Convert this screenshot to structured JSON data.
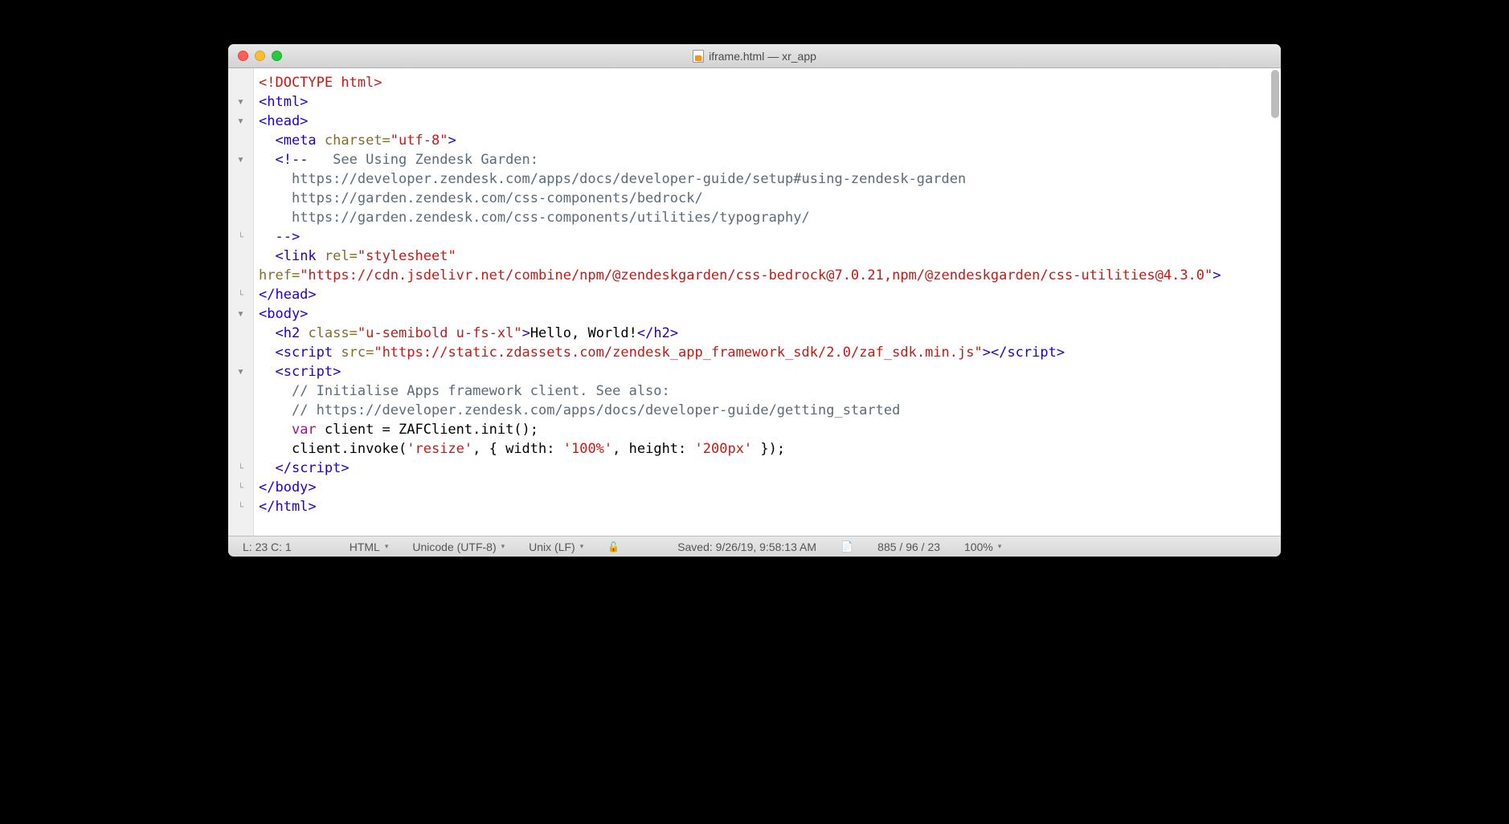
{
  "window": {
    "title": "iframe.html — xr_app"
  },
  "gutter": {
    "markers": [
      "",
      "▾",
      "▾",
      "",
      "▾",
      "",
      "",
      "",
      "∟",
      "",
      "",
      "∟",
      "▾",
      "",
      "",
      "▾",
      "",
      "",
      "",
      "",
      "∟",
      "∟",
      "∟"
    ]
  },
  "code": {
    "lines": [
      {
        "indent": 0,
        "tokens": [
          {
            "c": "c-doctype",
            "t": "<!DOCTYPE html>"
          }
        ]
      },
      {
        "indent": 0,
        "tokens": [
          {
            "c": "c-tag",
            "t": "<html>"
          }
        ]
      },
      {
        "indent": 0,
        "tokens": [
          {
            "c": "c-tag",
            "t": "<head>"
          }
        ]
      },
      {
        "indent": 1,
        "tokens": [
          {
            "c": "c-tag",
            "t": "<meta "
          },
          {
            "c": "c-attr",
            "t": "charset="
          },
          {
            "c": "c-str",
            "t": "\"utf-8\""
          },
          {
            "c": "c-tag",
            "t": ">"
          }
        ]
      },
      {
        "indent": 1,
        "tokens": [
          {
            "c": "c-tag",
            "t": "<!--"
          },
          {
            "c": "c-comment",
            "t": "   See Using Zendesk Garden:"
          }
        ]
      },
      {
        "indent": 2,
        "tokens": [
          {
            "c": "c-comment",
            "t": "https://developer.zendesk.com/apps/docs/developer-guide/setup#using-zendesk-garden"
          }
        ]
      },
      {
        "indent": 2,
        "tokens": [
          {
            "c": "c-comment",
            "t": "https://garden.zendesk.com/css-components/bedrock/"
          }
        ]
      },
      {
        "indent": 2,
        "tokens": [
          {
            "c": "c-comment",
            "t": "https://garden.zendesk.com/css-components/utilities/typography/"
          }
        ]
      },
      {
        "indent": 1,
        "tokens": [
          {
            "c": "c-tag",
            "t": "-->"
          }
        ]
      },
      {
        "indent": 1,
        "tokens": [
          {
            "c": "c-tag",
            "t": "<link "
          },
          {
            "c": "c-attr",
            "t": "rel="
          },
          {
            "c": "c-str",
            "t": "\"stylesheet\""
          }
        ]
      },
      {
        "indent": -1,
        "tokens": [
          {
            "c": "c-attr",
            "t": "href="
          },
          {
            "c": "c-str",
            "t": "\"https://cdn.jsdelivr.net/combine/npm/@zendeskgarden/css-bedrock@7.0.21,npm/@zendeskgarden/css-utilities@4.3.0\""
          },
          {
            "c": "c-tag",
            "t": ">"
          }
        ]
      },
      {
        "indent": 0,
        "tokens": [
          {
            "c": "c-tag",
            "t": "</head>"
          }
        ]
      },
      {
        "indent": 0,
        "tokens": [
          {
            "c": "c-tag",
            "t": "<body>"
          }
        ]
      },
      {
        "indent": 1,
        "tokens": [
          {
            "c": "c-tag",
            "t": "<h2 "
          },
          {
            "c": "c-attr",
            "t": "class="
          },
          {
            "c": "c-str",
            "t": "\"u-semibold u-fs-xl\""
          },
          {
            "c": "c-tag",
            "t": ">"
          },
          {
            "c": "c-text",
            "t": "Hello, World!"
          },
          {
            "c": "c-tag",
            "t": "</h2>"
          }
        ]
      },
      {
        "indent": 1,
        "tokens": [
          {
            "c": "c-tag",
            "t": "<script "
          },
          {
            "c": "c-attr",
            "t": "src="
          },
          {
            "c": "c-str",
            "t": "\"https://static.zdassets.com/zendesk_app_framework_sdk/2.0/zaf_sdk.min.js\""
          },
          {
            "c": "c-tag",
            "t": ">"
          },
          {
            "c": "c-tag",
            "t": "</script>"
          }
        ]
      },
      {
        "indent": 1,
        "tokens": [
          {
            "c": "c-tag",
            "t": "<script>"
          }
        ]
      },
      {
        "indent": 2,
        "tokens": [
          {
            "c": "c-comment",
            "t": "// Initialise Apps framework client. See also:"
          }
        ]
      },
      {
        "indent": 2,
        "tokens": [
          {
            "c": "c-comment",
            "t": "// https://developer.zendesk.com/apps/docs/developer-guide/getting_started"
          }
        ]
      },
      {
        "indent": 2,
        "tokens": [
          {
            "c": "c-kw",
            "t": "var"
          },
          {
            "c": "c-punc",
            "t": " client = ZAFClient.init();"
          }
        ]
      },
      {
        "indent": 2,
        "tokens": [
          {
            "c": "c-punc",
            "t": "client.invoke("
          },
          {
            "c": "c-jsstr",
            "t": "'resize'"
          },
          {
            "c": "c-punc",
            "t": ", { width: "
          },
          {
            "c": "c-jsstr",
            "t": "'100%'"
          },
          {
            "c": "c-punc",
            "t": ", height: "
          },
          {
            "c": "c-jsstr",
            "t": "'200px'"
          },
          {
            "c": "c-punc",
            "t": " });"
          }
        ]
      },
      {
        "indent": 1,
        "tokens": [
          {
            "c": "c-tag",
            "t": "</script>"
          }
        ]
      },
      {
        "indent": 0,
        "tokens": [
          {
            "c": "c-tag",
            "t": "</body>"
          }
        ]
      },
      {
        "indent": 0,
        "tokens": [
          {
            "c": "c-tag",
            "t": "</html>"
          }
        ]
      }
    ]
  },
  "status": {
    "cursor": "L: 23 C: 1",
    "language": "HTML",
    "encoding": "Unicode (UTF-8)",
    "line_endings": "Unix (LF)",
    "saved": "Saved: 9/26/19, 9:58:13 AM",
    "counts": "885 / 96 / 23",
    "zoom": "100%"
  }
}
